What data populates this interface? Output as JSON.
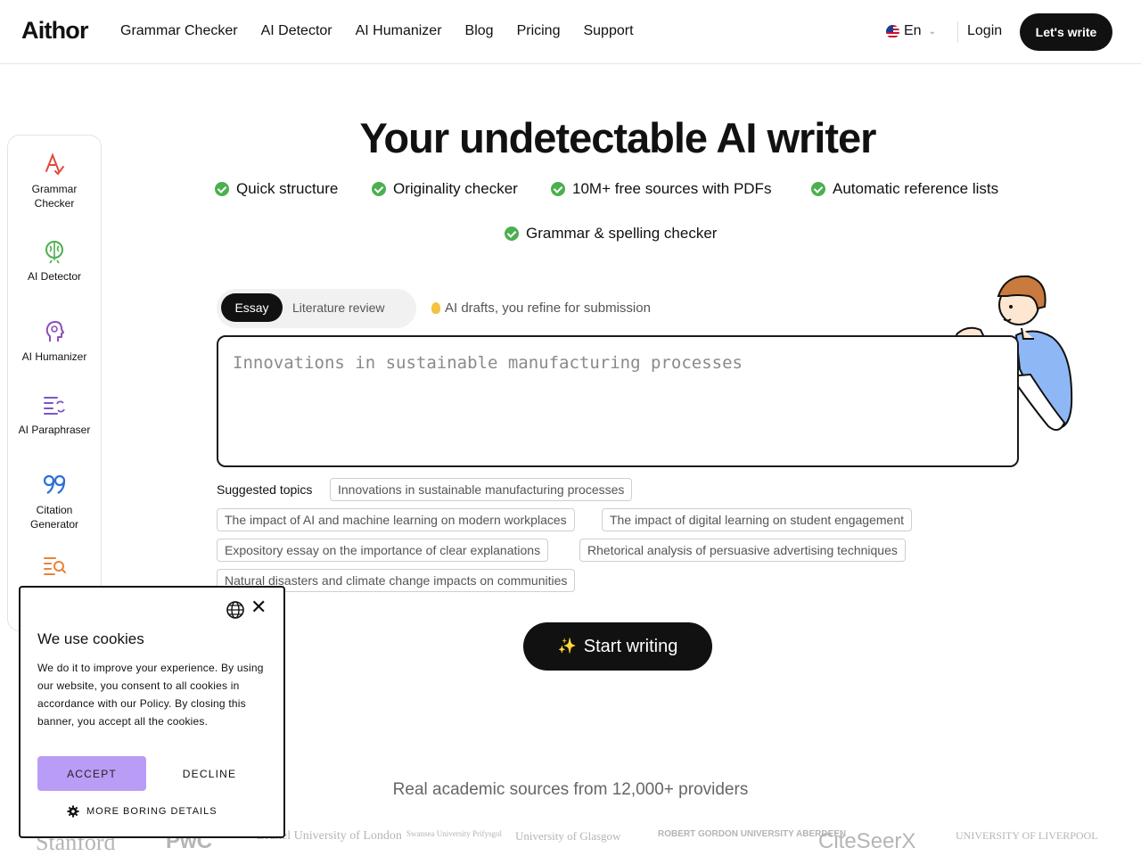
{
  "header": {
    "logo": "Aithor",
    "nav": [
      "Grammar Checker",
      "AI Detector",
      "AI Humanizer",
      "Blog",
      "Pricing",
      "Support"
    ],
    "language": "En",
    "login": "Login",
    "cta": "Let's write"
  },
  "sidebar": {
    "items": [
      {
        "label": "Grammar Checker",
        "icon": "grammar-check-icon"
      },
      {
        "label": "AI Detector",
        "icon": "brain-icon"
      },
      {
        "label": "AI Humanizer",
        "icon": "head-icon"
      },
      {
        "label": "AI Paraphraser",
        "icon": "paraphrase-icon"
      },
      {
        "label": "Citation Generator",
        "icon": "quote-icon"
      },
      {
        "label": "",
        "icon": "search-list-icon"
      }
    ]
  },
  "hero": {
    "title": "Your undetectable AI writer",
    "features": [
      "Quick structure",
      "Originality checker",
      "10M+ free sources with PDFs",
      "Automatic reference lists",
      "Grammar & spelling checker"
    ]
  },
  "editor": {
    "tabs": [
      "Essay",
      "Literature review"
    ],
    "hint": "AI drafts, you refine for submission",
    "placeholder": "Innovations in sustainable manufacturing processes"
  },
  "suggestions": {
    "label": "Suggested topics",
    "topics": [
      "Innovations in sustainable manufacturing processes",
      "The impact of AI and machine learning on modern workplaces",
      "The impact of digital learning on student engagement",
      "Expository essay on the importance of clear explanations",
      "Rhetorical analysis of persuasive advertising techniques",
      "Natural disasters and climate change impacts on communities"
    ]
  },
  "start_button": "Start writing",
  "sources": {
    "heading": "Real academic sources from 12,000+ providers",
    "logos": [
      "Stanford",
      "PwC",
      "Brunel University of London",
      "Swansea University Prifysgol",
      "University of Glasgow",
      "ROBERT GORDON UNIVERSITY ABERDEEN",
      "CiteSeerX",
      "UNIVERSITY OF LIVERPOOL"
    ]
  },
  "cookie": {
    "title": "We use cookies",
    "text": "We do it to improve your experience. By using our website, you consent to all cookies in accordance with our Policy. By closing this banner, you accept all the cookies.",
    "accept": "ACCEPT",
    "decline": "DECLINE",
    "details": "MORE BORING DETAILS"
  },
  "colors": {
    "primary": "#111111",
    "check": "#4caf50",
    "accept": "#b99cf5",
    "grammar_icon": "#e04a3f",
    "detector_icon": "#4caf50",
    "humanizer_icon": "#8e4fb8",
    "paraphraser_icon": "#7b55c7",
    "citation_icon": "#2a6fd6",
    "search_icon": "#e8833a"
  }
}
